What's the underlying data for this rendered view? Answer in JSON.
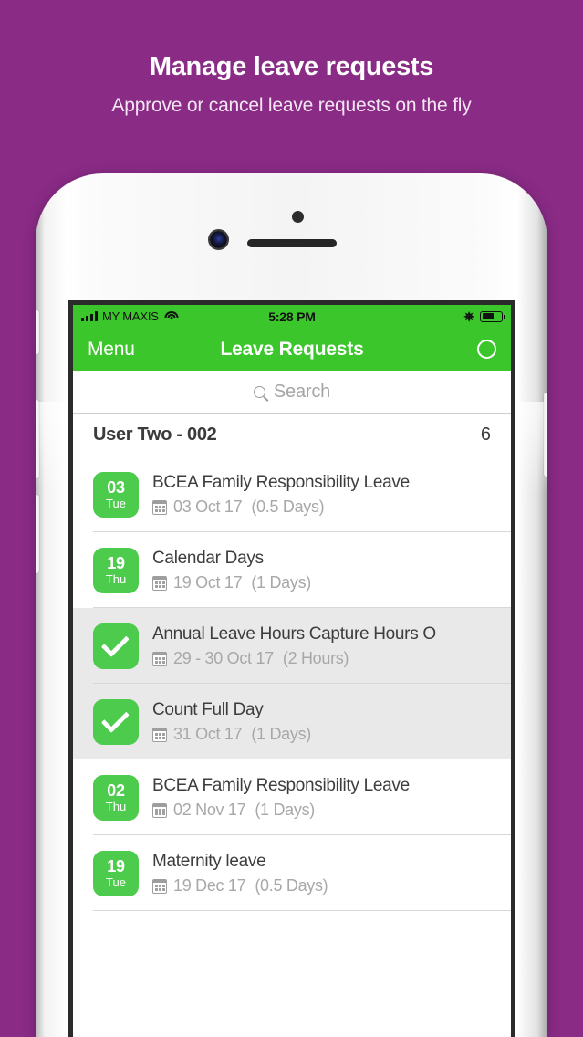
{
  "promo": {
    "title": "Manage leave requests",
    "subtitle": "Approve or cancel leave requests on the fly"
  },
  "colors": {
    "background_purple": "#8a2b86",
    "accent_green": "#3bc72b",
    "badge_green": "#4ccb4c",
    "selected_row": "#e9e9e9"
  },
  "status_bar": {
    "carrier": "MY MAXIS",
    "time": "5:28 PM",
    "signal_icon": "signal-bars-icon",
    "wifi_icon": "wifi-icon",
    "bluetooth_icon": "bluetooth-icon",
    "bluetooth_glyph": "✵",
    "battery_icon": "battery-icon"
  },
  "nav_bar": {
    "menu_label": "Menu",
    "title": "Leave Requests",
    "action_icon": "circle-outline-icon"
  },
  "search": {
    "placeholder": "Search",
    "icon": "search-icon",
    "value": ""
  },
  "group": {
    "name": "User Two - 002",
    "count": "6"
  },
  "list": {
    "items": [
      {
        "badge_type": "date",
        "badge_day": "03",
        "badge_dow": "Tue",
        "title": "BCEA Family Responsibility Leave",
        "date": "03 Oct 17",
        "duration": "(0.5 Days)",
        "selected": false,
        "calendar_icon": "calendar-icon"
      },
      {
        "badge_type": "date",
        "badge_day": "19",
        "badge_dow": "Thu",
        "title": "Calendar Days",
        "date": "19 Oct 17",
        "duration": "(1 Days)",
        "selected": false,
        "calendar_icon": "calendar-icon"
      },
      {
        "badge_type": "check",
        "badge_day": "",
        "badge_dow": "",
        "title": "Annual Leave Hours Capture Hours O",
        "date": "29 - 30 Oct 17",
        "duration": "(2 Hours)",
        "selected": true,
        "calendar_icon": "calendar-icon"
      },
      {
        "badge_type": "check",
        "badge_day": "",
        "badge_dow": "",
        "title": "Count Full Day",
        "date": "31 Oct 17",
        "duration": "(1 Days)",
        "selected": true,
        "calendar_icon": "calendar-icon"
      },
      {
        "badge_type": "date",
        "badge_day": "02",
        "badge_dow": "Thu",
        "title": "BCEA Family Responsibility Leave",
        "date": "02 Nov 17",
        "duration": "(1 Days)",
        "selected": false,
        "calendar_icon": "calendar-icon"
      },
      {
        "badge_type": "date",
        "badge_day": "19",
        "badge_dow": "Tue",
        "title": "Maternity leave",
        "date": "19 Dec 17",
        "duration": "(0.5 Days)",
        "selected": false,
        "calendar_icon": "calendar-icon"
      }
    ]
  },
  "device": {
    "speaker_icon": "earpiece-speaker",
    "camera_icon": "front-camera",
    "sensor_icon": "proximity-sensor",
    "buttons": [
      "silent-switch",
      "volume-up-button",
      "volume-down-button",
      "power-button"
    ]
  }
}
